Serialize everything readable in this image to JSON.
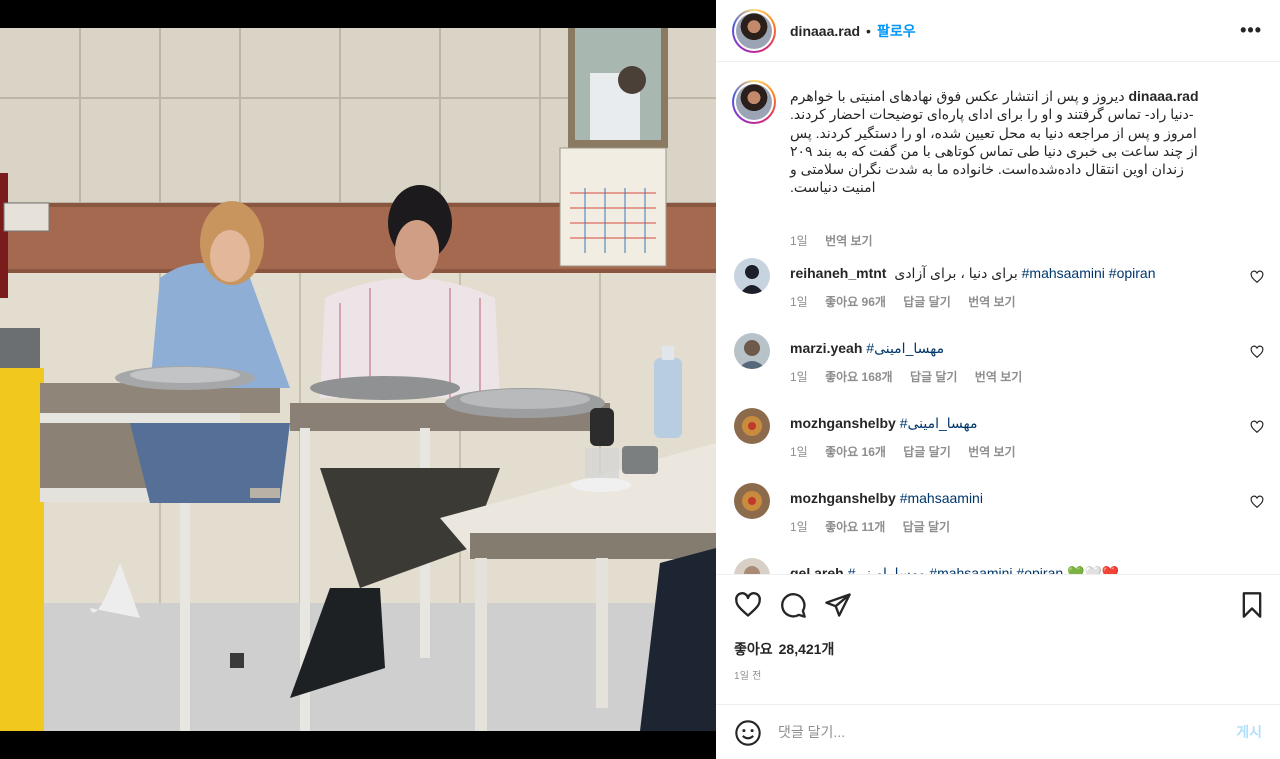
{
  "post": {
    "username": "dinaaa.rad",
    "follow_label": "팔로우",
    "more_label": "•••"
  },
  "caption": {
    "username": "dinaaa.rad",
    "text": "دیروز و پس از انتشار عکس فوق نهادهای امنیتی با خواهرم\n-دنیا راد- تماس گرفتند و او را برای ادای پاره‌ای توضیحات احضار کردند.\nامروز و پس از مراجعه دنیا به محل تعیین شده، او را دستگیر کردند. پس\nاز چند ساعت بی خبری دنیا طی تماس کوتاهی با من گفت که به بند ۲۰۹\nزندان اوین انتقال داده‌شده‌است. خانواده ما به شدت نگران سلامتی و\nامنیت دنیاست.",
    "age": "1일",
    "translate_label": "번역 보기"
  },
  "comments": [
    {
      "user": "reihaneh_mtnt",
      "text_plain": "برای دنیا ، برای آزادی",
      "tags": "#mahsaamini #opiran",
      "age": "1일",
      "likes": "좋아요 96개",
      "reply": "답글 달기",
      "translate": "번역 보기"
    },
    {
      "user": "marzi.yeah",
      "text_plain": "",
      "tags": "#مهسا_امینی",
      "age": "1일",
      "likes": "좋아요 168개",
      "reply": "답글 달기",
      "translate": "번역 보기"
    },
    {
      "user": "mozhganshelby",
      "text_plain": "",
      "tags": "#مهسا_امینی",
      "age": "1일",
      "likes": "좋아요 16개",
      "reply": "답글 달기",
      "translate": "번역 보기"
    },
    {
      "user": "mozhganshelby",
      "text_plain": "",
      "tags": "#mahsaamini",
      "age": "1일",
      "likes": "좋아요 11개",
      "reply": "답글 달기",
      "translate": ""
    },
    {
      "user": "gel.areh",
      "text_plain": "",
      "tags": "#مهسا_امینی #mahsaamini #opiran",
      "emoji": "💚🤍❤️",
      "age": "",
      "likes": "",
      "reply": "",
      "translate": ""
    }
  ],
  "footer": {
    "likes_label": "좋아요",
    "likes_count": "28,421개",
    "time": "1일 전",
    "comment_placeholder": "댓글 달기...",
    "post_label": "게시"
  },
  "colors": {
    "accent": "#0095f6",
    "hashtag": "#00376b",
    "muted": "#8e8e8e",
    "post_disabled": "#b2dffc"
  },
  "icons": [
    "more-icon",
    "heart-icon",
    "comment-icon",
    "share-icon",
    "bookmark-icon",
    "emoji-icon"
  ]
}
